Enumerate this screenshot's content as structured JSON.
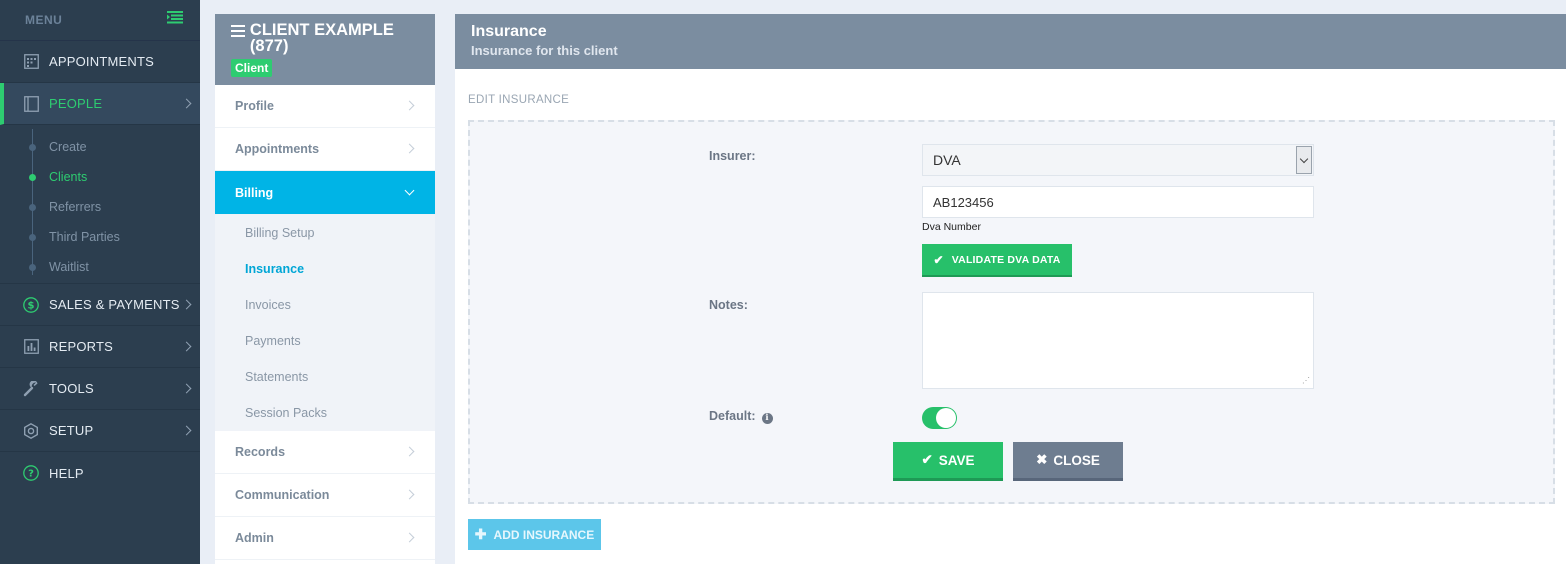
{
  "nav": {
    "menu_label": "MENU",
    "items": [
      {
        "label": "APPOINTMENTS",
        "icon": "calendar-icon"
      },
      {
        "label": "PEOPLE",
        "icon": "people-book-icon"
      },
      {
        "label": "SALES & PAYMENTS",
        "icon": "dollar-icon"
      },
      {
        "label": "REPORTS",
        "icon": "bar-chart-icon"
      },
      {
        "label": "TOOLS",
        "icon": "wrench-icon"
      },
      {
        "label": "SETUP",
        "icon": "gear-icon"
      },
      {
        "label": "HELP",
        "icon": "question-icon"
      }
    ],
    "people_sub": [
      "Create",
      "Clients",
      "Referrers",
      "Third Parties",
      "Waitlist"
    ],
    "accent_color": "#2ecc71"
  },
  "client": {
    "title": "CLIENT EXAMPLE (877)",
    "badge": "Client",
    "menu": {
      "profile": "Profile",
      "appointments": "Appointments",
      "billing": "Billing",
      "records": "Records",
      "communication": "Communication",
      "admin": "Admin"
    },
    "billing_sub": [
      "Billing Setup",
      "Insurance",
      "Invoices",
      "Payments",
      "Statements",
      "Session Packs"
    ],
    "active_color": "#00b4e6"
  },
  "main": {
    "title": "Insurance",
    "subtitle": "Insurance for this client",
    "section_label": "EDIT INSURANCE",
    "form": {
      "insurer_label": "Insurer:",
      "insurer_value": "DVA",
      "dva_number_value": "AB123456",
      "dva_number_hint": "Dva Number",
      "validate_label": "VALIDATE DVA DATA",
      "notes_label": "Notes:",
      "notes_value": "",
      "default_label": "Default:",
      "default_on": true,
      "save_label": "SAVE",
      "close_label": "CLOSE"
    },
    "add_label": "ADD INSURANCE"
  }
}
